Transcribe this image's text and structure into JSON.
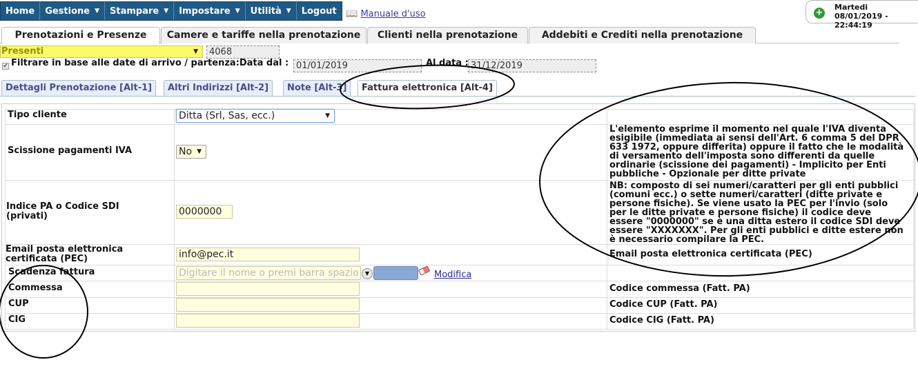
{
  "topnav": {
    "items": [
      {
        "label": "Home",
        "caret": false
      },
      {
        "label": "Gestione",
        "caret": true
      },
      {
        "label": "Stampare",
        "caret": true
      },
      {
        "label": "Impostare",
        "caret": true
      },
      {
        "label": "Utilità",
        "caret": true
      },
      {
        "label": "Logout",
        "caret": false
      }
    ],
    "manual_link": "Manuale d'uso"
  },
  "datetime": {
    "day": "Martedi",
    "datetime": "08/01/2019 - 22:44:19"
  },
  "main_tabs": [
    {
      "label": "Prenotazioni e Presenze",
      "active": true
    },
    {
      "label": "Camere e tariffe nella prenotazione",
      "active": false
    },
    {
      "label": "Clienti nella prenotazione",
      "active": false
    },
    {
      "label": "Addebiti e Crediti nella prenotazione",
      "active": false
    }
  ],
  "filter": {
    "presence_select": "Presenti",
    "booking_number": "4068",
    "checkbox_label": "Filtrare in base alle date di arrivo / partenza:Data dal :",
    "checked": true,
    "date_from": "01/01/2019",
    "date_to_label": "Al data :",
    "date_to": "31/12/2019"
  },
  "sub_tabs": [
    {
      "label": "Dettagli Prenotazione [Alt-1]",
      "active": false
    },
    {
      "label": "Altri Indirizzi [Alt-2]",
      "active": false
    },
    {
      "label": "Note [Alt-3]",
      "active": false
    },
    {
      "label": "Fattura elettronica [Alt-4]",
      "active": true
    }
  ],
  "form": {
    "tipo_cliente": {
      "label": "Tipo cliente",
      "value": "Ditta (Srl, Sas, ecc.)"
    },
    "scissione": {
      "label": "Scissione pagamenti IVA",
      "value": "No",
      "help": [
        "L'elemento esprime il momento nel quale l'IVA diventa",
        "esigibile (immediata ai sensi dell'Art. 6 comma 5 del DPR",
        "633 1972, oppure differita) oppure il fatto che le modalità",
        "di versamento dell'imposta sono differenti da quelle",
        "ordinarie (scissione dei pagamenti) - Implicito per Enti",
        "pubbliche - Opzionale per ditte private"
      ]
    },
    "indice_pa": {
      "label": "Indice PA o Codice SDI (privati)",
      "value": "0000000",
      "help": [
        "NB: composto di sei numeri/caratteri per gli enti pubblici",
        "(comuni ecc.) o sette numeri/caratteri (ditte private e",
        "persone fisiche). Se viene usato la PEC per l'invio (solo",
        "per le ditte private e persone fisiche) il codice deve",
        "essere \"0000000\" se è una ditta estero il codice SDI deve",
        "essere \"XXXXXXX\". Per gli enti pubblici e ditte estere non",
        "è necessario compilare la PEC."
      ]
    },
    "pec": {
      "label": "Email posta elettronica certificata (PEC)",
      "value": "info@pec.it",
      "help": "Email posta elettronica certificata (PEC)"
    },
    "scadenza": {
      "label": "Scadenza fattura",
      "placeholder": "Digitare il nome o premi barra spazio",
      "link": "Modifica"
    },
    "commessa": {
      "label": "Commessa",
      "value": "",
      "help": "Codice commessa (Fatt. PA)"
    },
    "cup": {
      "label": "CUP",
      "value": "",
      "help": "Codice CUP (Fatt. PA)"
    },
    "cig": {
      "label": "CIG",
      "value": "",
      "help": "Codice CIG (Fatt. PA)"
    }
  },
  "colors": {
    "nav_bg": "#1f5a86",
    "field_bg": "#ffffe0",
    "presenti_bg": "#fbfb6a",
    "link": "#2b2b9b",
    "swatch": "#8aa8d4"
  }
}
